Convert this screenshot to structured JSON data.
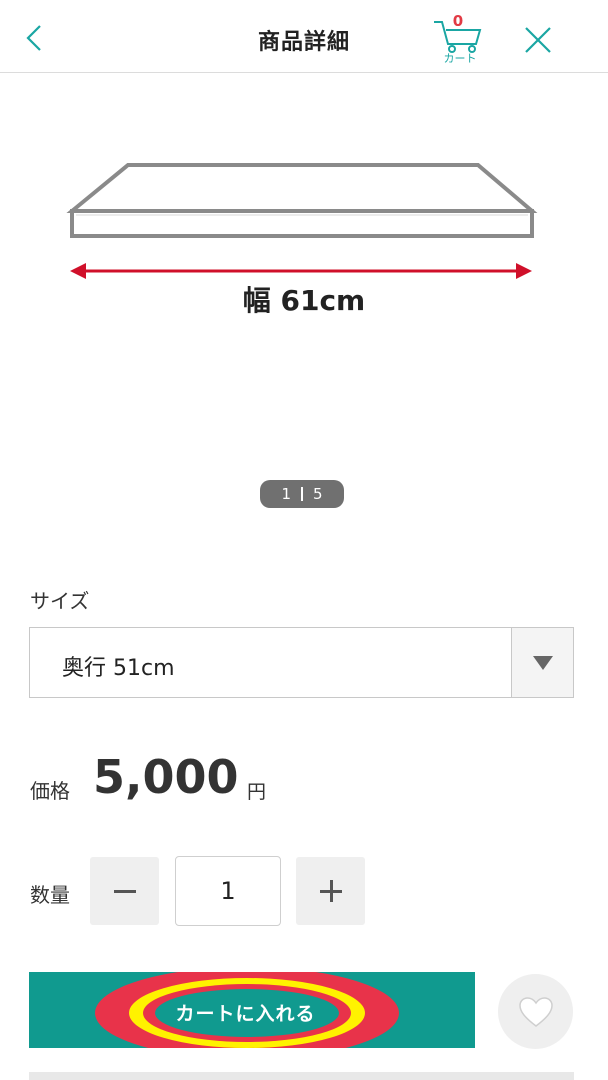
{
  "header": {
    "title": "商品詳細",
    "back_icon": "chevron-left-icon",
    "cart": {
      "count": "0",
      "label": "カート",
      "icon": "cart-icon"
    },
    "close_icon": "close-icon"
  },
  "product_image": {
    "dimension_label": "幅 61cm",
    "pager": {
      "current": "1",
      "total": "5"
    }
  },
  "size": {
    "label": "サイズ",
    "selected": "奥行 51cm"
  },
  "price": {
    "label": "価格",
    "value": "5,000",
    "unit": "円"
  },
  "quantity": {
    "label": "数量",
    "value": "1",
    "minus_icon": "minus-icon",
    "plus_icon": "plus-icon"
  },
  "actions": {
    "add_to_cart_label": "カートに入れる",
    "favorite_icon": "heart-icon"
  },
  "colors": {
    "accent_teal": "#109a8f",
    "header_teal": "#1aa6a3",
    "cart_count_red": "#e23a44",
    "dimension_arrow_red": "#d0102a",
    "highlight_red": "#e8334a",
    "highlight_yellow": "#fff200"
  }
}
